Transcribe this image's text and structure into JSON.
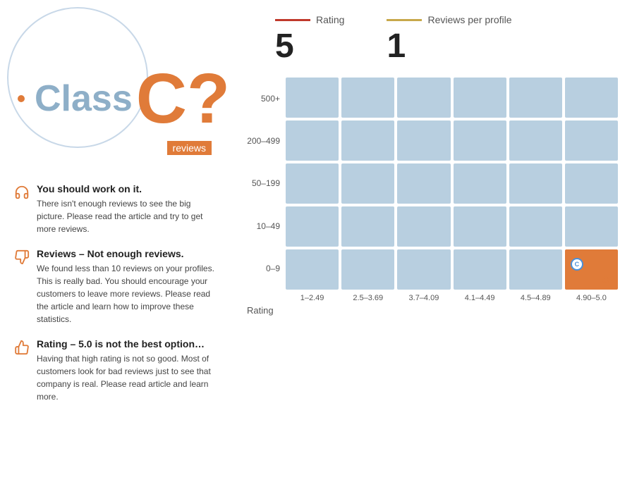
{
  "left": {
    "class_text": "Class",
    "class_letter": "C",
    "question_mark": "?",
    "reviews_tag": "reviews",
    "dot_color": "#e07b39",
    "info_items": [
      {
        "id": "work-on-it",
        "icon": "headset",
        "title": "You should work on it.",
        "desc": "There isn't enough reviews to see the big picture. Please read the article and try to get more reviews."
      },
      {
        "id": "not-enough",
        "icon": "thumbsdown",
        "title": "Reviews – Not enough reviews.",
        "desc": "We found less than 10 reviews on your profiles. This is really bad. You should encourage your customers to leave more reviews. Please read the article and learn how to improve these statistics."
      },
      {
        "id": "rating-note",
        "icon": "thumbsup",
        "title": "Rating – 5.0 is not the best option…",
        "desc": "Having that high rating is not so good. Most of customers look for bad reviews just to see that company is real. Please read article and learn more."
      }
    ]
  },
  "right": {
    "rating_label": "Rating",
    "rating_value": "5",
    "reviews_per_profile_label": "Reviews per profile",
    "reviews_per_profile_value": "1",
    "y_labels": [
      "500+",
      "200–499",
      "50–199",
      "10–49",
      "0–9"
    ],
    "x_labels": [
      "1–2.49",
      "2.5–3.69",
      "3.7–4.09",
      "4.1–4.49",
      "4.5–4.89",
      "4.90–5.0"
    ],
    "x_axis_title": "Rating",
    "highlighted_cell": {
      "row": 4,
      "col": 5
    }
  }
}
